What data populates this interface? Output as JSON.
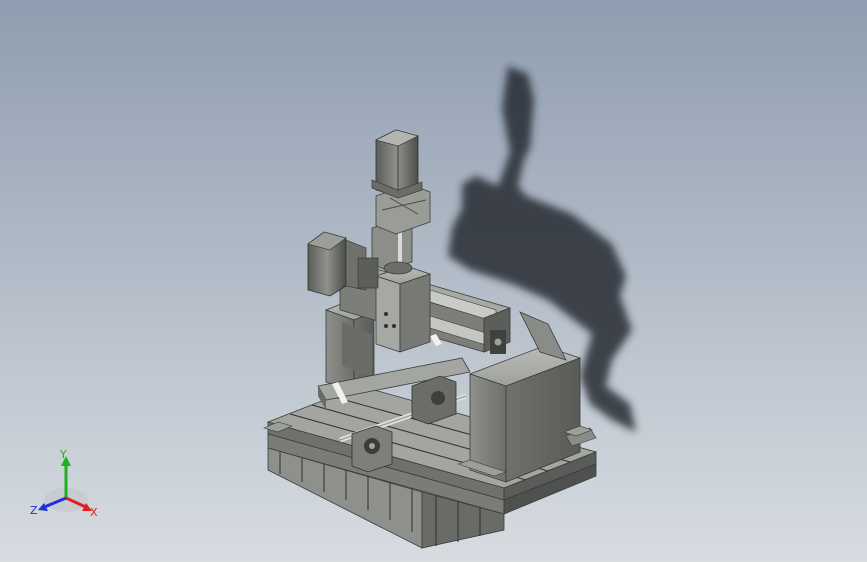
{
  "viewport": {
    "background_top": "#8f9db0",
    "background_bottom": "#d7dce1",
    "model_color": "#8a8c88",
    "shadow_color": "#1f2429"
  },
  "triad": {
    "x_label": "X",
    "y_label": "Y",
    "z_label": "Z",
    "x_color": "#e02020",
    "y_color": "#20b020",
    "z_color": "#2030e0"
  }
}
